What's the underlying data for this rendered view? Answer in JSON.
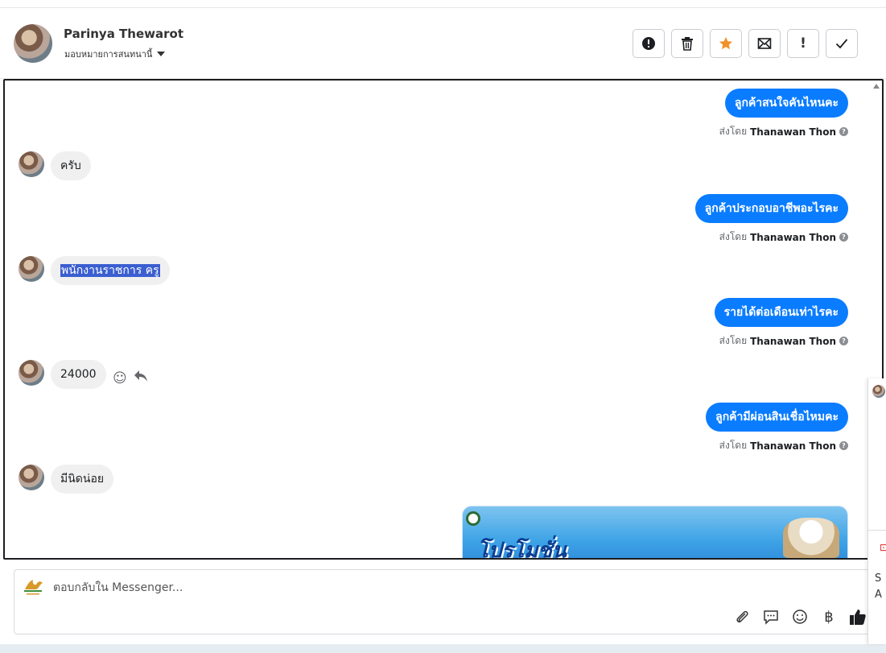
{
  "header": {
    "name": "Parinya Thewarot",
    "assign_label": "มอบหมายการสนทนานี้",
    "toolbar": [
      {
        "name": "spam-button",
        "icon": "alert-circle-icon"
      },
      {
        "name": "delete-button",
        "icon": "trash-icon"
      },
      {
        "name": "star-button",
        "icon": "star-icon"
      },
      {
        "name": "mark-unread-button",
        "icon": "envelope-icon"
      },
      {
        "name": "follow-up-button",
        "icon": "exclamation-icon"
      },
      {
        "name": "done-button",
        "icon": "check-icon"
      }
    ],
    "star_color": "#f0922a"
  },
  "messages": [
    {
      "dir": "out",
      "text": "ลูกค้าสนใจคันไหนคะ",
      "sent_by_prefix": "ส่งโดย",
      "sent_by": "Thanawan Thon"
    },
    {
      "dir": "in",
      "text": "ครับ"
    },
    {
      "dir": "out",
      "text": "ลูกค้าประกอบอาชีพอะไรคะ",
      "sent_by_prefix": "ส่งโดย",
      "sent_by": "Thanawan Thon"
    },
    {
      "dir": "in",
      "text": "พนักงานราชการ ครู",
      "selected": true
    },
    {
      "dir": "out",
      "text": "รายได้ต่อเดือนเท่าไรคะ",
      "sent_by_prefix": "ส่งโดย",
      "sent_by": "Thanawan Thon"
    },
    {
      "dir": "in",
      "text": "24000"
    },
    {
      "dir": "out",
      "text": "ลูกค้ามีผ่อนสินเชื่อไหมคะ",
      "sent_by_prefix": "ส่งโดย",
      "sent_by": "Thanawan Thon"
    },
    {
      "dir": "in",
      "text": "มีนิดน่อย"
    }
  ],
  "promo": {
    "title": "โปรโมชั่น"
  },
  "composer": {
    "placeholder": "ตอบกลับใน Messenger...",
    "tools": [
      "paperclip-icon",
      "chat-bubble-icon",
      "emoji-icon",
      "baht-icon",
      "thumbs-up-icon"
    ],
    "baht_symbol": "฿"
  },
  "side_panel": {
    "line1": "S",
    "line2": "A"
  },
  "colors": {
    "outgoing_bubble": "#0a7cff",
    "incoming_bubble": "#f0f0f0",
    "selection": "#3b5fd0"
  }
}
